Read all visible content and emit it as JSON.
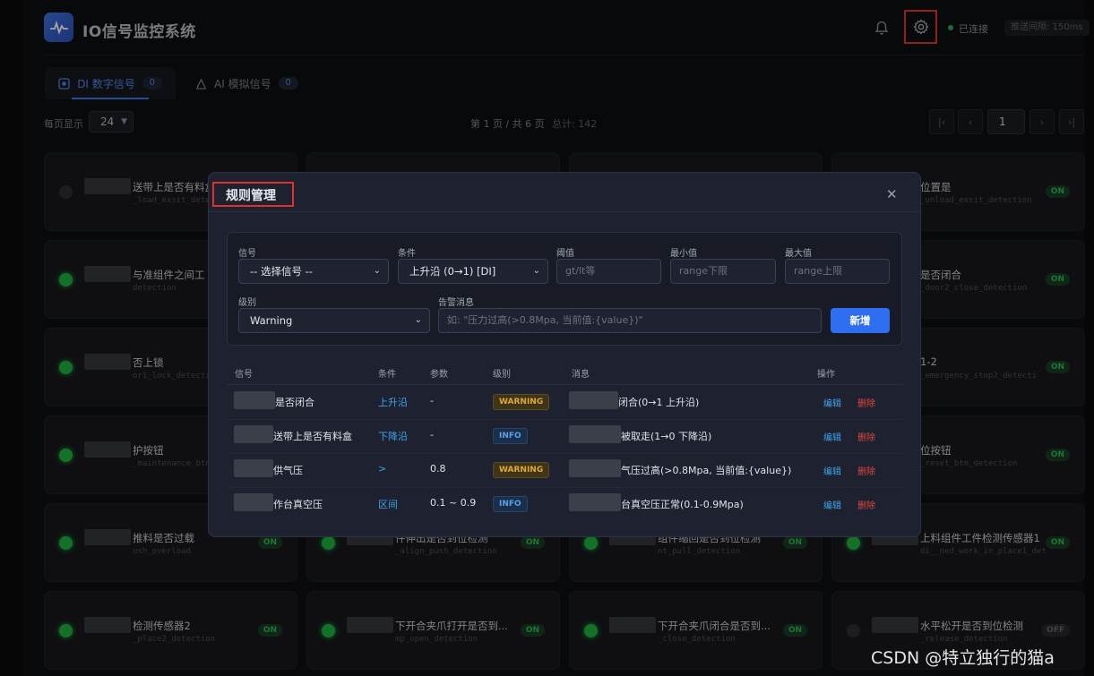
{
  "header": {
    "app_title": "IO信号监控系统",
    "connection_status": "已连接",
    "latency": "推送间隔: 150ms"
  },
  "tabs": [
    {
      "label": "DI 数字信号",
      "count": "0",
      "active": true
    },
    {
      "label": "AI 模拟信号",
      "count": "0",
      "active": false
    }
  ],
  "toolbar": {
    "per_page_label": "每页显示",
    "per_page_value": "24",
    "page_info": "第 1 页 / 共 6 页",
    "total": "总计: 142",
    "page_input": "1",
    "first_glyph": "|‹",
    "prev_glyph": "‹",
    "next_glyph": "›",
    "last_glyph": "›|"
  },
  "cards": [
    {
      "name": "送带上是否有料盒",
      "code": "_load_exsit_detection",
      "status": "",
      "on": false
    },
    {
      "name": "",
      "code": "",
      "status": "",
      "on": true
    },
    {
      "name": "",
      "code": "",
      "status": "",
      "on": true
    },
    {
      "name": "位置是",
      "code": "_unload_exsit_detection",
      "status": "ON",
      "on": true
    },
    {
      "name": "与准组件之间工",
      "code": "detection",
      "status": "",
      "on": true
    },
    {
      "name": "",
      "code": "",
      "status": "",
      "on": true
    },
    {
      "name": "",
      "code": "",
      "status": "",
      "on": true
    },
    {
      "name": "是否闭合",
      "code": "_door2_close_detection",
      "status": "ON",
      "on": true
    },
    {
      "name": "否上锁",
      "code": "or1_lock_detection",
      "status": "",
      "on": true
    },
    {
      "name": "",
      "code": "",
      "status": "",
      "on": true
    },
    {
      "name": "",
      "code": "",
      "status": "",
      "on": true
    },
    {
      "name": "1-2",
      "code": "_emergency_stop2_detecti",
      "status": "ON",
      "on": true
    },
    {
      "name": "护按钮",
      "code": "_maintenance_btn_",
      "status": "",
      "on": true
    },
    {
      "name": "",
      "code": "",
      "status": "",
      "on": true
    },
    {
      "name": "",
      "code": "",
      "status": "",
      "on": true
    },
    {
      "name": "位按钮",
      "code": "_reset_btn_detection",
      "status": "ON",
      "on": true
    },
    {
      "name": "推料是否过载",
      "code": "ush_overload",
      "status": "ON",
      "on": true
    },
    {
      "name": "件伸出是否到位检测",
      "code": "_align_push_detection",
      "status": "ON",
      "on": true
    },
    {
      "name": "组件缩回是否到位检测",
      "code": "nt_pull_detection",
      "status": "ON",
      "on": true
    },
    {
      "name": "上料组件工件检测传感器1",
      "code": "di__ned_work_in_place1_detection",
      "status": "ON",
      "on": true
    },
    {
      "name": "检测传感器2",
      "code": "_place2_detection",
      "status": "ON",
      "on": true
    },
    {
      "name": "下开合夹爪打开是否到...",
      "code": "mp_open_detection",
      "status": "ON",
      "on": true
    },
    {
      "name": "下开合夹爪闭合是否到...",
      "code": "_close_detection",
      "status": "ON",
      "on": true
    },
    {
      "name": "水平松开是否到位检测",
      "code": "_release_detection",
      "status": "OFF",
      "on": false
    }
  ],
  "modal": {
    "title": "规则管理",
    "close_glyph": "✕",
    "form": {
      "signal_label": "信号",
      "signal_value": "-- 选择信号 --",
      "condition_label": "条件",
      "condition_value": "上升沿 (0→1) [DI]",
      "threshold_label": "阈值",
      "threshold_placeholder": "gt/lt等",
      "min_label": "最小值",
      "min_placeholder": "range下限",
      "max_label": "最大值",
      "max_placeholder": "range上限",
      "level_label": "级别",
      "level_value": "Warning",
      "message_label": "告警消息",
      "message_placeholder": "如: \"压力过高(>0.8Mpa, 当前值:{value})\"",
      "add_button": "新增"
    },
    "table": {
      "headers": {
        "signal": "信号",
        "condition": "条件",
        "params": "参数",
        "level": "级别",
        "message": "消息",
        "actions": "操作"
      },
      "rows": [
        {
          "signal": "是否闭合",
          "condition": "上升沿",
          "params": "-",
          "level": "WARNING",
          "message": "闭合(0→1 上升沿)"
        },
        {
          "signal": "送带上是否有料盒",
          "condition": "下降沿",
          "params": "-",
          "level": "INFO",
          "message": "被取走(1→0 下降沿)"
        },
        {
          "signal": "供气压",
          "condition": ">",
          "params": "0.8",
          "level": "WARNING",
          "message": "气压过高(>0.8Mpa, 当前值:{value})"
        },
        {
          "signal": "作台真空压",
          "condition": "区间",
          "params": "0.1 ~ 0.9",
          "level": "INFO",
          "message": "台真空压正常(0.1-0.9Mpa)"
        }
      ],
      "edit_label": "编辑",
      "delete_label": "删除"
    }
  },
  "watermark": "CSDN @特立独行的猫a",
  "colors": {
    "accent": "#2f6ef0",
    "on_led": "#1fae3e",
    "highlight": "#e0322c"
  }
}
